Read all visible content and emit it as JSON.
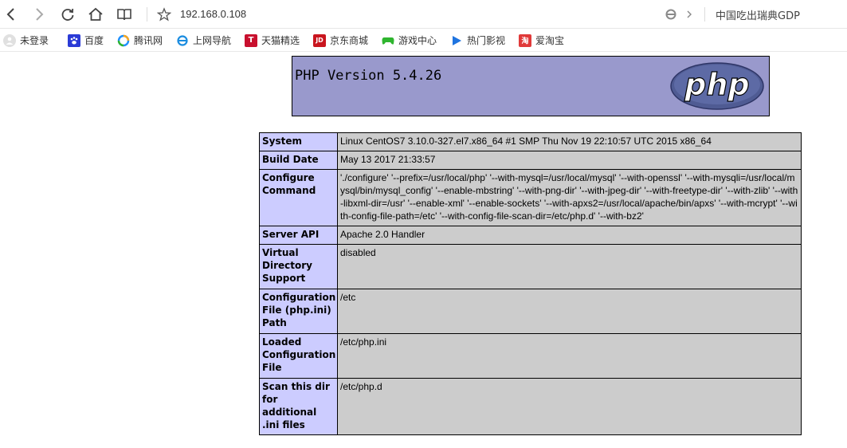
{
  "browser": {
    "url": "192.168.0.108",
    "search_text": "中国吃出瑞典GDP"
  },
  "bookmarks": [
    {
      "label": "未登录",
      "icon": "user-avatar-icon",
      "color": "#d0d0d0"
    },
    {
      "label": "百度",
      "icon": "baidu-paw-icon",
      "color": "#2b3bd6"
    },
    {
      "label": "腾讯网",
      "icon": "tencent-icon",
      "color": "#1e90ff"
    },
    {
      "label": "上网导航",
      "icon": "ie-icon",
      "color": "#1a8ce0"
    },
    {
      "label": "天猫精选",
      "icon": "tmall-icon",
      "color": "#c8102e"
    },
    {
      "label": "京东商城",
      "icon": "jd-icon",
      "color": "#c9151e"
    },
    {
      "label": "游戏中心",
      "icon": "gamepad-icon",
      "color": "#2fb52f"
    },
    {
      "label": "热门影视",
      "icon": "video-play-icon",
      "color": "#1f74e0"
    },
    {
      "label": "爱淘宝",
      "icon": "taobao-icon",
      "color": "#e03a3a"
    }
  ],
  "php": {
    "version_title": "PHP Version 5.4.26",
    "logo_text": "php",
    "colors": {
      "header": "#9999cc",
      "key": "#ccccff",
      "value": "#cccccc"
    },
    "rows": [
      {
        "key": "System",
        "value": "Linux CentOS7 3.10.0-327.el7.x86_64 #1 SMP Thu Nov 19 22:10:57 UTC 2015 x86_64"
      },
      {
        "key": "Build Date",
        "value": "May 13 2017 21:33:57"
      },
      {
        "key": "Configure Command",
        "value": "'./configure' '--prefix=/usr/local/php' '--with-mysql=/usr/local/mysql' '--with-openssl' '--with-mysqli=/usr/local/mysql/bin/mysql_config' '--enable-mbstring' '--with-png-dir' '--with-jpeg-dir' '--with-freetype-dir' '--with-zlib' '--with-libxml-dir=/usr' '--enable-xml' '--enable-sockets' '--with-apxs2=/usr/local/apache/bin/apxs' '--with-mcrypt' '--with-config-file-path=/etc' '--with-config-file-scan-dir=/etc/php.d' '--with-bz2'"
      },
      {
        "key": "Server API",
        "value": "Apache 2.0 Handler"
      },
      {
        "key": "Virtual Directory Support",
        "value": "disabled"
      },
      {
        "key": "Configuration File (php.ini) Path",
        "value": "/etc"
      },
      {
        "key": "Loaded Configuration File",
        "value": "/etc/php.ini"
      },
      {
        "key": "Scan this dir for additional .ini files",
        "value": "/etc/php.d"
      }
    ]
  }
}
